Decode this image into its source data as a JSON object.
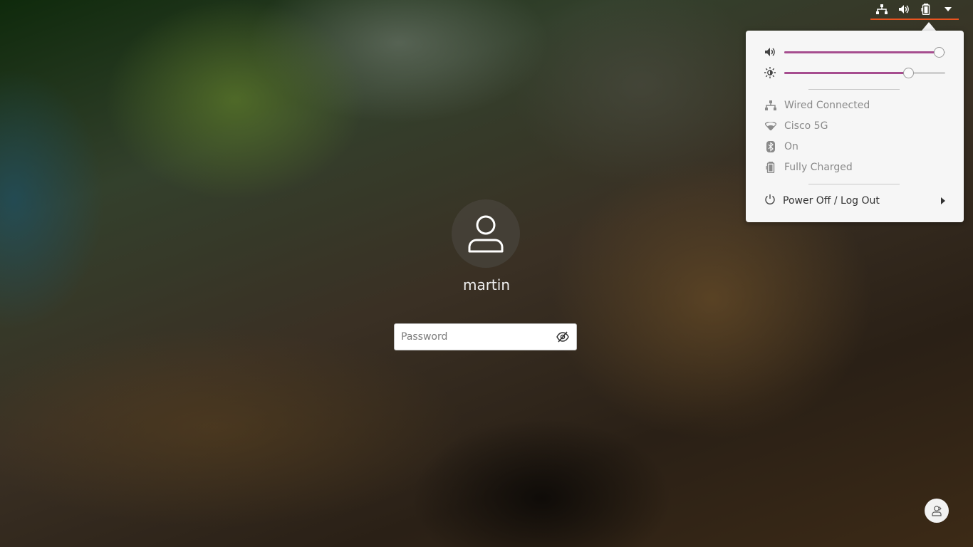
{
  "topbar": {
    "icons": [
      "network-wired-icon",
      "volume-icon",
      "battery-icon",
      "dropdown-arrow-icon"
    ],
    "accent": "#e95420"
  },
  "system_menu": {
    "volume": {
      "icon": "volume-icon",
      "level_pct": 96
    },
    "brightness": {
      "icon": "brightness-icon",
      "level_pct": 77
    },
    "network": {
      "icon": "network-wired-icon",
      "label": "Wired Connected"
    },
    "wifi": {
      "icon": "wifi-icon",
      "label": "Cisco 5G"
    },
    "bluetooth": {
      "icon": "bluetooth-icon",
      "label": "On"
    },
    "battery": {
      "icon": "battery-icon",
      "label": "Fully Charged"
    },
    "power": {
      "icon": "power-icon",
      "label": "Power Off / Log Out"
    },
    "slider_color": "#a64d8f"
  },
  "login": {
    "username": "martin",
    "password_placeholder": "Password",
    "password_value": ""
  },
  "bottom": {
    "switch_user_icon": "switch-user-icon"
  }
}
